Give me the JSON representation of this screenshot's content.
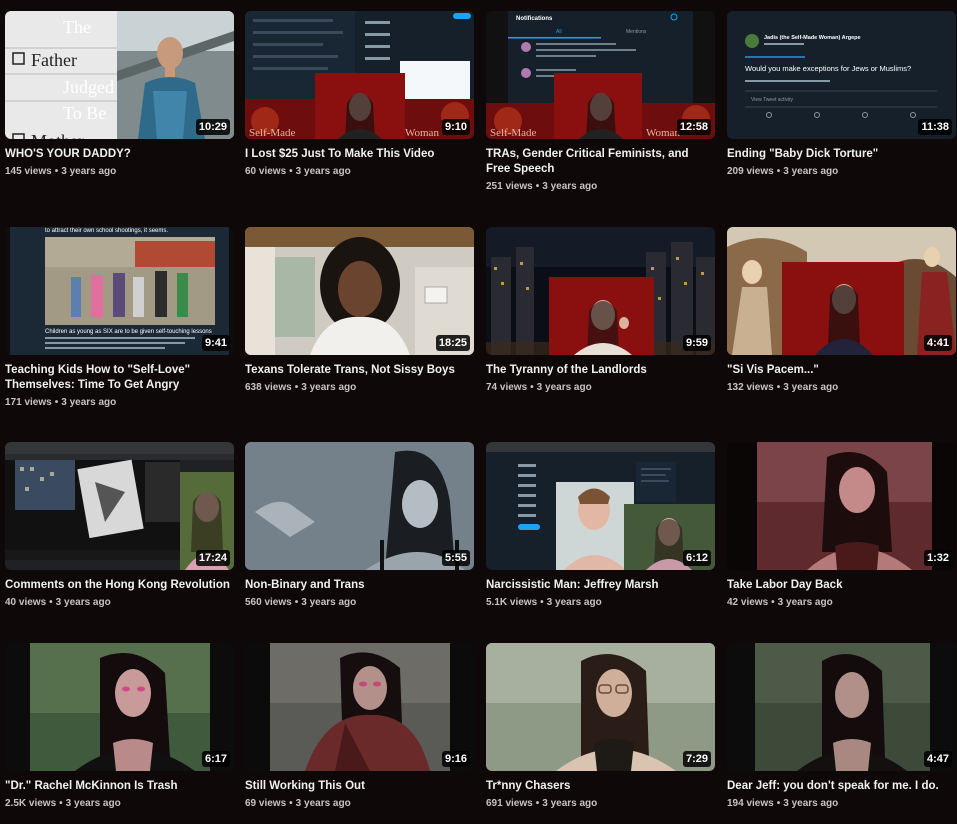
{
  "videos": [
    {
      "title": "WHO'S YOUR DADDY?",
      "views": "145 views",
      "age": "3 years ago",
      "duration": "10:29",
      "thumb_text": [
        "The",
        "Father",
        "Judged",
        "To Be",
        "Mother"
      ]
    },
    {
      "title": "I Lost $25 Just To Make This Video",
      "views": "60 views",
      "age": "3 years ago",
      "duration": "9:10",
      "thumb_text": [
        "Self-Made",
        "Woman"
      ]
    },
    {
      "title": "TRAs, Gender Critical Feminists, and Free Speech",
      "views": "251 views",
      "age": "3 years ago",
      "duration": "12:58",
      "thumb_text": [
        "Notifications",
        "All",
        "Mentions",
        "Self-Made",
        "Woman"
      ]
    },
    {
      "title": "Ending \"Baby Dick Torture\"",
      "views": "209 views",
      "age": "3 years ago",
      "duration": "11:38",
      "thumb_text": [
        "Jadis (the Self-Made Woman) Argepe",
        "Would you make exceptions for Jews or Muslims?",
        "View Tweet activity"
      ]
    },
    {
      "title": "Teaching Kids How to \"Self-Love\" Themselves: Time To Get Angry",
      "views": "171 views",
      "age": "3 years ago",
      "duration": "9:41",
      "thumb_text": [
        "to attract their own school shootings, it seems.",
        "Children as young as SIX are to be given self-touching lessons"
      ]
    },
    {
      "title": "Texans Tolerate Trans, Not Sissy Boys",
      "views": "638 views",
      "age": "3 years ago",
      "duration": "18:25"
    },
    {
      "title": "The Tyranny of the Landlords",
      "views": "74 views",
      "age": "3 years ago",
      "duration": "9:59"
    },
    {
      "title": "\"Si Vis Pacem...\"",
      "views": "132 views",
      "age": "3 years ago",
      "duration": "4:41"
    },
    {
      "title": "Comments on the Hong Kong Revolution",
      "views": "40 views",
      "age": "3 years ago",
      "duration": "17:24"
    },
    {
      "title": "Non-Binary and Trans",
      "views": "560 views",
      "age": "3 years ago",
      "duration": "5:55"
    },
    {
      "title": "Narcissistic Man: Jeffrey Marsh",
      "views": "5.1K views",
      "age": "3 years ago",
      "duration": "6:12"
    },
    {
      "title": "Take Labor Day Back",
      "views": "42 views",
      "age": "3 years ago",
      "duration": "1:32"
    },
    {
      "title": "\"Dr.\" Rachel McKinnon Is Trash",
      "views": "2.5K views",
      "age": "3 years ago",
      "duration": "6:17"
    },
    {
      "title": "Still Working This Out",
      "views": "69 views",
      "age": "3 years ago",
      "duration": "9:16"
    },
    {
      "title": "Tr*nny Chasers",
      "views": "691 views",
      "age": "3 years ago",
      "duration": "7:29"
    },
    {
      "title": "Dear Jeff: you don't speak for me. I do.",
      "views": "194 views",
      "age": "3 years ago",
      "duration": "4:47"
    }
  ],
  "colors": {
    "background": "#0f0808",
    "title": "#f1f1f1",
    "meta": "#c9c4c4",
    "badge": "#000000"
  }
}
